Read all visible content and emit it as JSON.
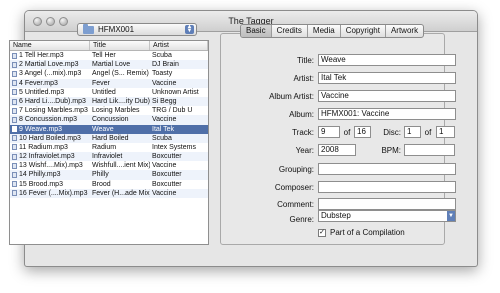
{
  "window": {
    "title": "The Tagger"
  },
  "folder_popup": {
    "value": "HFMX001"
  },
  "file_list": {
    "columns": [
      "Name",
      "Title",
      "Artist"
    ],
    "rows": [
      [
        "1 Tell Her.mp3",
        "Tell Her",
        "Scuba"
      ],
      [
        "2 Martial Love.mp3",
        "Martial Love",
        "DJ Brain"
      ],
      [
        "3 Angel (...mix).mp3",
        "Angel (S... Remix)",
        "Toasty"
      ],
      [
        "4 Fever.mp3",
        "Fever",
        "Vaccine"
      ],
      [
        "5 Untitled.mp3",
        "Untitled",
        "Unknown Artist"
      ],
      [
        "6 Hard Li....Dub).mp3",
        "Hard Lik....ity Dub)",
        "Si Begg"
      ],
      [
        "7 Losing Marbles.mp3",
        "Losing Marbles",
        "TRG / Dub U"
      ],
      [
        "8 Concussion.mp3",
        "Concussion",
        "Vaccine"
      ],
      [
        "9 Weave.mp3",
        "Weave",
        "Ital Tek"
      ],
      [
        "10 Hard Boiled.mp3",
        "Hard Boiled",
        "Scuba"
      ],
      [
        "11 Radium.mp3",
        "Radium",
        "Intex Systems"
      ],
      [
        "12 Infraviolet.mp3",
        "Infraviolet",
        "Boxcutter"
      ],
      [
        "13 Wishf....Mix).mp3",
        "Wishfull....ient Mix)",
        "Vaccine"
      ],
      [
        "14 Philly.mp3",
        "Philly",
        "Boxcutter"
      ],
      [
        "15 Brood.mp3",
        "Brood",
        "Boxcutter"
      ],
      [
        "16 Fever (....Mix).mp3",
        "Fever (H...ade Mix)",
        "Vaccine"
      ]
    ],
    "selected_index": 8
  },
  "tabs": [
    "Basic",
    "Credits",
    "Media",
    "Copyright",
    "Artwork"
  ],
  "active_tab": "Basic",
  "form": {
    "title_label": "Title:",
    "title_value": "Weave",
    "artist_label": "Artist:",
    "artist_value": "Ital Tek",
    "album_artist_label": "Album Artist:",
    "album_artist_value": "Vaccine",
    "album_label": "Album:",
    "album_value": "HFMX001: Vaccine",
    "track_label": "Track:",
    "track_value": "9",
    "track_of_label": "of",
    "track_total": "16",
    "disc_label": "Disc:",
    "disc_value": "1",
    "disc_of_label": "of",
    "disc_total": "1",
    "year_label": "Year:",
    "year_value": "2008",
    "bpm_label": "BPM:",
    "bpm_value": "",
    "grouping_label": "Grouping:",
    "grouping_value": "",
    "composer_label": "Composer:",
    "composer_value": "",
    "comment_label": "Comment:",
    "comment_value": "",
    "genre_label": "Genre:",
    "genre_value": "Dubstep",
    "compilation_label": "Part of a Compilation",
    "compilation_checked": true
  }
}
